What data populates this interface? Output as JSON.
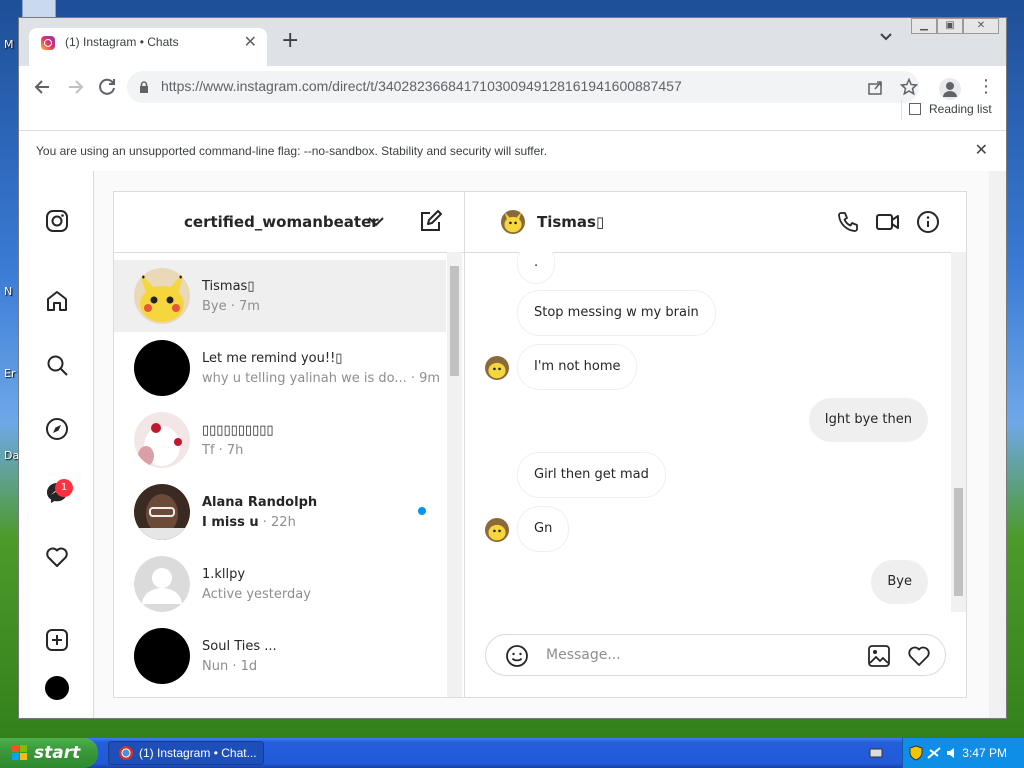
{
  "desktop": {
    "labels": [
      "M",
      "N",
      "Er",
      "Da"
    ]
  },
  "browser": {
    "tab_title": "(1) Instagram • Chats",
    "url": "https://www.instagram.com/direct/t/340282366841710300949128161941600887457",
    "reading_list": "Reading list",
    "infobar": "You are using an unsupported command-line flag: --no-sandbox. Stability and security will suffer."
  },
  "instagram": {
    "nav_badge": "1",
    "account": "certified_womanbeater",
    "threads": [
      {
        "name": "Tismas▯",
        "sub": "Bye · 7m",
        "avatar": "pikachu",
        "active": true
      },
      {
        "name": "Let me remind you!!▯",
        "sub": "why u telling yalinah we is do... · 9m",
        "avatar": "black"
      },
      {
        "name": "▯▯▯▯▯▯▯▯▯▯",
        "sub": "Tf · 7h",
        "avatar": "photo-pink"
      },
      {
        "name": "Alana Randolph",
        "sub_bold": "I miss u",
        "sub_time": " · 22h",
        "avatar": "photo-face",
        "unread": true
      },
      {
        "name": "1.kllpy",
        "sub": "Active yesterday",
        "avatar": "default"
      },
      {
        "name": "Soul Ties ...",
        "sub": "Nun · 1d",
        "avatar": "black"
      }
    ],
    "chat": {
      "name": "Tismas▯",
      "messages": [
        {
          "text": ".",
          "dir": "recv"
        },
        {
          "text": "Stop messing w my brain",
          "dir": "recv"
        },
        {
          "text": "I'm not home",
          "dir": "recv"
        },
        {
          "text": "Ight bye then",
          "dir": "sent"
        },
        {
          "text": "Girl then get mad",
          "dir": "recv"
        },
        {
          "text": "Gn",
          "dir": "recv"
        },
        {
          "text": "Bye",
          "dir": "sent"
        }
      ],
      "placeholder": "Message..."
    }
  },
  "taskbar": {
    "start": "start",
    "task": "(1) Instagram • Chat...",
    "time": "3:47 PM"
  },
  "colors": {
    "accent_blue": "#0095f6",
    "badge_red": "#ff3040",
    "taskbar_blue": "#245edc",
    "start_green": "#3a9a3a"
  }
}
